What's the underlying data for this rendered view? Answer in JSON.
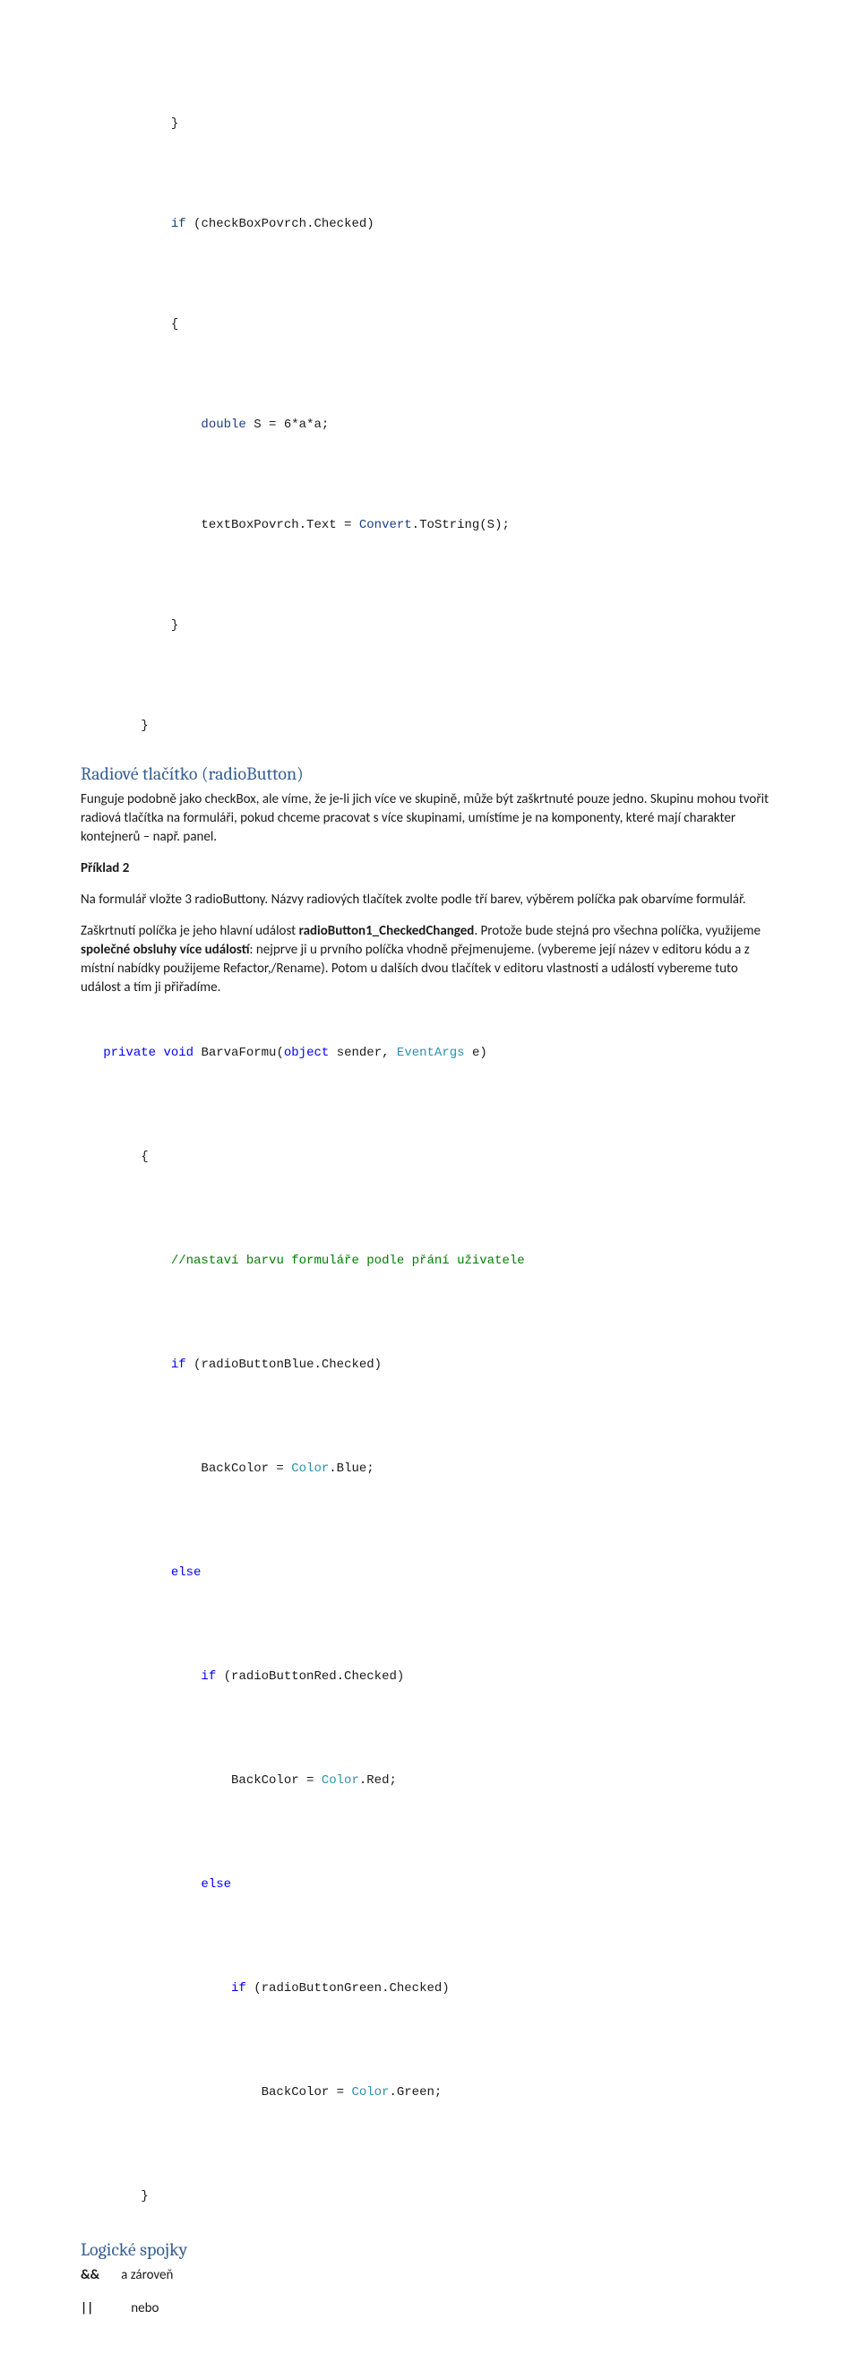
{
  "code1": {
    "l1": "            }",
    "l2a": "            ",
    "l2_if": "if",
    "l2b": " (checkBoxPovrch.Checked)",
    "l3": "            {",
    "l4a": "                ",
    "l4_dbl": "double",
    "l4b": " S = 6*a*a;",
    "l5a": "                textBoxPovrch.Text = ",
    "l5_conv": "Convert",
    "l5b": ".ToString(S);",
    "l6": "            }",
    "l7": "        }"
  },
  "h1": "Radiové tlačítko (radioButton)",
  "p1": "Funguje podobně jako checkBox, ale víme, že je-li jich více ve skupině, může být zaškrtnuté pouze jedno. Skupinu mohou tvořit radiová tlačítka na formuláři, pokud chceme pracovat s více skupinami, umístíme je na komponenty, které mají charakter kontejnerů – např. panel.",
  "p2_label": "Příklad 2",
  "p3": "Na formulář vložte 3 radioButtony. Názvy radiových tlačítek zvolte podle tří barev, výběrem políčka pak obarvíme formulář.",
  "p4a": "Zaškrtnutí políčka je jeho hlavní událost ",
  "p4b_bold": "radioButton1_CheckedChanged",
  "p4c": ". Protože bude stejná pro všechna políčka, využijeme ",
  "p4d_bold": "společné obsluhy více událostí",
  "p4e": ": nejprve ji u prvního políčka vhodně přejmenujeme. (vybereme její název v editoru kódu a z místní nabídky použijeme Refactor,/Rename). Potom u dalších dvou tlačítek v editoru vlastností a událostí vybereme tuto událost a tím ji přiřadíme.",
  "code2": {
    "l1": {
      "pad": "   ",
      "private": "private",
      "sp1": " ",
      "void": "void",
      "txt1": " BarvaFormu(",
      "object": "object",
      "txt2": " sender, ",
      "eventargs": "EventArgs",
      "txt3": " e)"
    },
    "l2": "        {",
    "l3": {
      "pad": "            ",
      "comment": "//nastaví barvu formuláře podle přání uživatele"
    },
    "l4": {
      "pad": "            ",
      "if": "if",
      "txt": " (radioButtonBlue.Checked)"
    },
    "l5": {
      "pad": "                BackColor = ",
      "color": "Color",
      "tail": ".Blue;"
    },
    "l6": {
      "pad": "            ",
      "else": "else"
    },
    "l7": {
      "pad": "                ",
      "if": "if",
      "txt": " (radioButtonRed.Checked)"
    },
    "l8": {
      "pad": "                    BackColor = ",
      "color": "Color",
      "tail": ".Red;"
    },
    "l9": {
      "pad": "                ",
      "else": "else"
    },
    "l10": {
      "pad": "                    ",
      "if": "if",
      "txt": " (radioButtonGreen.Checked)"
    },
    "l11": {
      "pad": "                        BackColor = ",
      "color": "Color",
      "tail": ".Green;"
    },
    "l12": "        }"
  },
  "h2": "Logické spojky",
  "row1": {
    "sym": "&&",
    "label": "a zároveň"
  },
  "row2": {
    "sym": "||",
    "label": "nebo"
  }
}
